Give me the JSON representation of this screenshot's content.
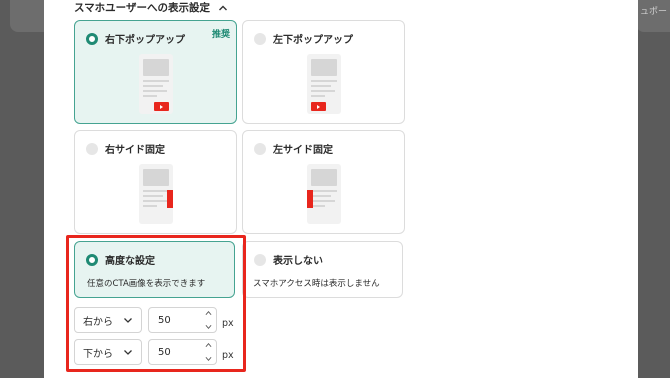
{
  "section": {
    "title": "スマホユーザーへの表示設定"
  },
  "background": {
    "right_text": "ュポート"
  },
  "options": [
    {
      "label": "右下ポップアップ",
      "badge": "推奨",
      "selected": true
    },
    {
      "label": "左下ポップアップ",
      "selected": false
    },
    {
      "label": "右サイド固定",
      "selected": false
    },
    {
      "label": "左サイド固定",
      "selected": false
    },
    {
      "label": "高度な設定",
      "description": "任意のCTA画像を表示できます",
      "selected": true
    },
    {
      "label": "表示しない",
      "description": "スマホアクセス時は表示しません",
      "selected": false
    }
  ],
  "advanced": {
    "horizontal": {
      "direction": "右から",
      "value": "50",
      "unit": "px"
    },
    "vertical": {
      "direction": "下から",
      "value": "50",
      "unit": "px"
    }
  },
  "colors": {
    "accent": "#1f8a74",
    "selected_bg": "#e7f4f1",
    "highlight": "#e8261d"
  }
}
